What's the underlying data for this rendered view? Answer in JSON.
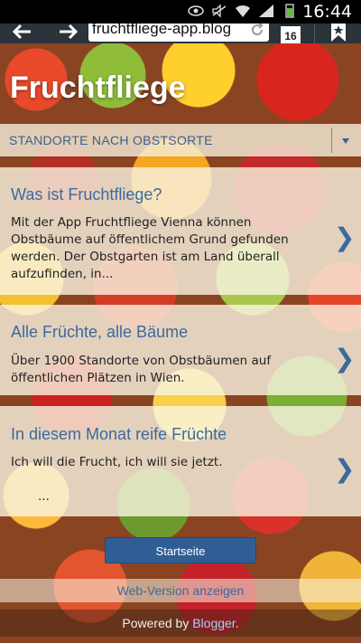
{
  "status_bar": {
    "time": "16:44",
    "icons": [
      "eye-icon",
      "mute-icon",
      "wifi-icon",
      "signal-icon",
      "battery-icon"
    ]
  },
  "browser": {
    "url": "fruchtfliege-app.blog",
    "tab_count": "16"
  },
  "page": {
    "title": "Fruchtfliege",
    "dropdown_label": "STANDORTE NACH OBSTSORTE",
    "cards": [
      {
        "title": "Was ist Fruchtfliege?",
        "text": "Mit der App Fruchtfliege Vienna können Obstbäume auf öffentlichem Grund gefunden werden. Der Obstgarten ist am Land überall aufzufinden, in..."
      },
      {
        "title": "Alle Früchte, alle Bäume",
        "text": "Über 1900 Standorte von Obstbäumen auf öffentlichen Plätzen in Wien."
      },
      {
        "title": "In diesem Monat reife Früchte",
        "text": "Ich will die Frucht, ich will sie jetzt.",
        "ellipsis": "..."
      }
    ],
    "start_button": "Startseite",
    "web_version_link": "Web-Version anzeigen",
    "powered_by_prefix": "Powered by ",
    "powered_by_brand": "Blogger",
    "powered_by_suffix": "."
  },
  "colors": {
    "accent_blue": "#3a6a9e",
    "button_blue": "#2f5d94",
    "toolbar_dark": "#2b333b"
  }
}
